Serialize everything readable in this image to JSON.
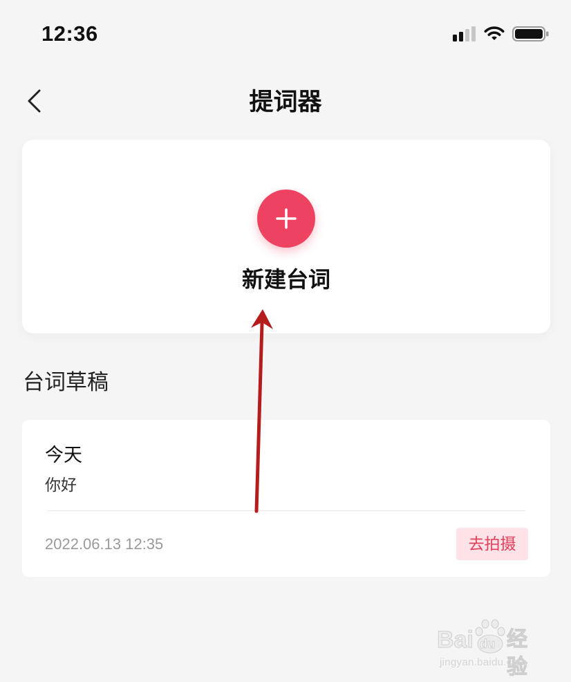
{
  "status_bar": {
    "time": "12:36",
    "icons": [
      "signal-icon",
      "wifi-icon",
      "battery-icon"
    ]
  },
  "nav": {
    "back_icon": "chevron-left-icon",
    "title": "提词器"
  },
  "new_script": {
    "icon": "plus-icon",
    "label": "新建台词"
  },
  "drafts": {
    "heading": "台词草稿",
    "items": [
      {
        "title": "今天",
        "content": "你好",
        "timestamp": "2022.06.13 12:35",
        "action_label": "去拍摄"
      }
    ]
  },
  "watermark": {
    "brand_left": "Bai",
    "brand_paw": "du",
    "brand_right": "经验",
    "url": "jingyan.baidu.com"
  },
  "colors": {
    "background": "#f5f5f5",
    "card": "#ffffff",
    "accent": "#ee4360",
    "action_bg": "#fde3e8",
    "action_text": "#e2405c",
    "timestamp_text": "#9a9a9a",
    "annotation_arrow": "#b51d1d"
  }
}
